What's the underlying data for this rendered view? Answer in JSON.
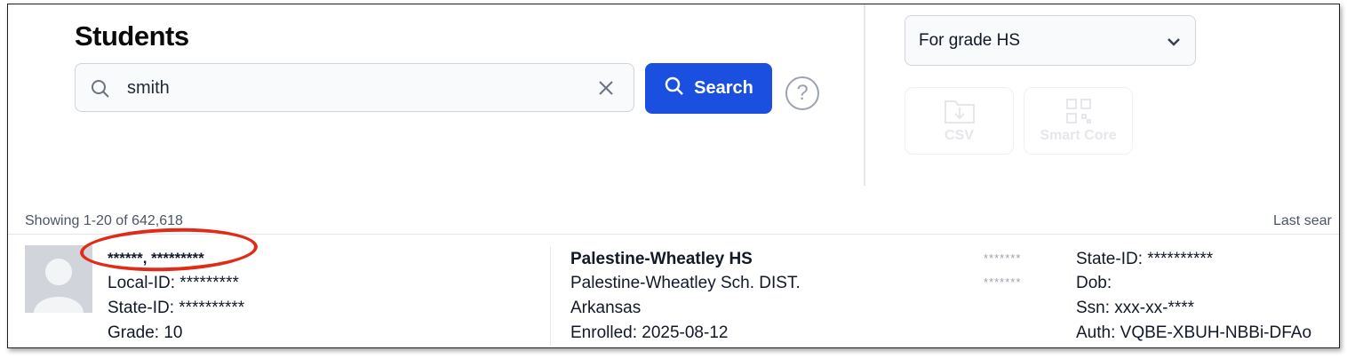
{
  "page": {
    "title": "Students"
  },
  "search": {
    "value": "smith",
    "button_label": "Search",
    "help_label": "?"
  },
  "filters": {
    "grade_selected": "For grade HS"
  },
  "actions": [
    {
      "label": "CSV",
      "icon": "folder-download-icon"
    },
    {
      "label": "Smart Core",
      "icon": "qr-code-icon"
    }
  ],
  "results": {
    "showing": "Showing 1-20 of 642,618",
    "last_search": "Last sear"
  },
  "student": {
    "name": "******, *********",
    "local_id": "Local-ID: *********",
    "state_id": "State-ID: **********",
    "grade": "Grade: 10",
    "school": "Palestine-Wheatley HS",
    "district": "Palestine-Wheatley Sch. DIST.",
    "state": "Arkansas",
    "enrolled": "Enrolled: 2025-08-12",
    "masked_1": "*******",
    "masked_2": "*******",
    "state_id_2": "State-ID: **********",
    "dob": "Dob:",
    "ssn": "Ssn: xxx-xx-****",
    "auth": "Auth: VQBE-XBUH-NBBi-DFAo"
  },
  "colors": {
    "primary": "#1a4fe0",
    "annotation": "#e02b18",
    "border": "#d1d5db"
  }
}
